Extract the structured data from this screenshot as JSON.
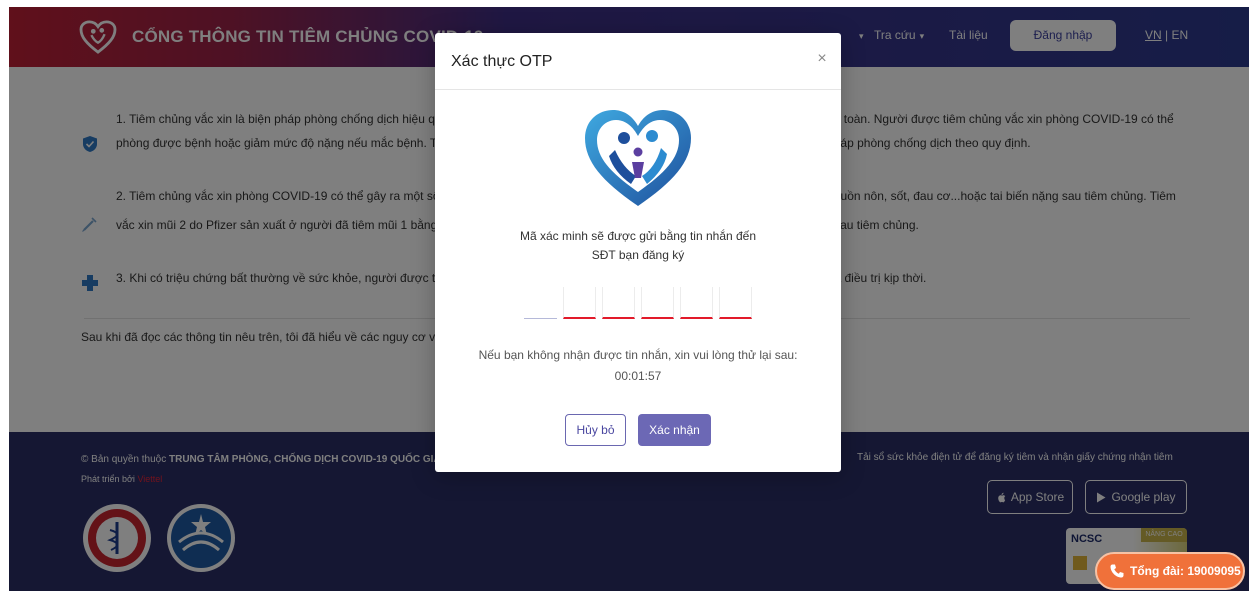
{
  "header": {
    "brand": "CỔNG THÔNG TIN TIÊM CHỦNG COVID-19",
    "nav": {
      "lookup": "Tra cứu",
      "documents": "Tài liệu"
    },
    "login": "Đăng nhập",
    "lang_vn": "VN",
    "lang_sep": "|",
    "lang_en": "EN"
  },
  "rules": [
    {
      "line1": "1. Tiêm chủng vắc xin là biện pháp phòng chống dịch hiệu quả, tuy nhiên vắc xin phòng COVID-19 có thể không phòng được bệnh hoàn toàn. Người được tiêm chủng vắc xin phòng COVID-19 có thể",
      "line2": "phòng được bệnh hoặc giảm mức độ nặng nếu mắc bệnh. Tuy nhiên, sau khi tiêm chủng vẫn phải tiếp tục thực hiện nghiêm các biện pháp phòng chống dịch theo quy định."
    },
    {
      "line1": "2. Tiêm chủng vắc xin phòng COVID-19 có thể gây ra một số biểu hiện tại chỗ tiêm hoặc toàn thân như sưng, đau chỗ tiêm, nhức đầu, buồn nôn, sốt, đau cơ...hoặc tai biến nặng sau tiêm chủng. Tiêm",
      "line2": "vắc xin mũi 2 do Pfizer sản xuất ở người đã tiêm mũi 1 bằng vắc xin AstraZeneca có thể tăng khả năng xảy ra phản ứng thông thường sau tiêm chủng."
    },
    {
      "line1": "3. Khi có triệu chứng bất thường về sức khỏe, người được tiêm chủng cần đến ngay cơ sở y tế gần nhất để được tư vấn, thăm khám và điều trị kịp thời."
    }
  ],
  "agree_text": "Sau khi đã đọc các thông tin nêu trên, tôi đã hiểu về các nguy cơ và:",
  "footer": {
    "copyright_prefix": "© Bản quyền thuộc",
    "copyright_owner": "TRUNG TÂM PHÒNG, CHỐNG DỊCH COVID-19 QUỐC GIA",
    "dev_prefix": "Phát triển bởi",
    "dev_brand": "Viettel",
    "app_desc": "Tải sổ sức khỏe điện tử để đăng ký tiêm và nhận giấy chứng nhận tiêm",
    "app_store": "App Store",
    "google_play": "Google play",
    "ncsc": "NCSC",
    "ncsc_badge": "NÂNG CAO"
  },
  "hotline": "Tổng đài: 19009095",
  "modal": {
    "title": "Xác thực OTP",
    "close": "×",
    "message_line1": "Mã xác minh sẽ được gửi bằng tin nhắn đến",
    "message_line2": "SĐT bạn đăng ký",
    "otp_values": [
      "",
      "",
      "",
      "",
      "",
      ""
    ],
    "retry_text": "Nếu bạn không nhận được tin nhắn, xin vui lòng thử lại sau:",
    "countdown": "00:01:57",
    "cancel": "Hủy bỏ",
    "confirm": "Xác nhận"
  },
  "colors": {
    "header_start": "#c02136",
    "header_end": "#2d3a8f",
    "footer_bg": "#2a2f66",
    "accent": "#6c68b5",
    "otp_underline": "#e21a2a",
    "hotline": "#f0713a",
    "icon_blue": "#2f78c4"
  },
  "icons": [
    "logo-heart-icon",
    "chevron-down-icon",
    "shield-icon",
    "syringe-icon",
    "plus-icon",
    "close-icon",
    "apple-icon",
    "play-icon",
    "phone-icon",
    "seal-ministry-icon",
    "seal-dept-icon"
  ]
}
